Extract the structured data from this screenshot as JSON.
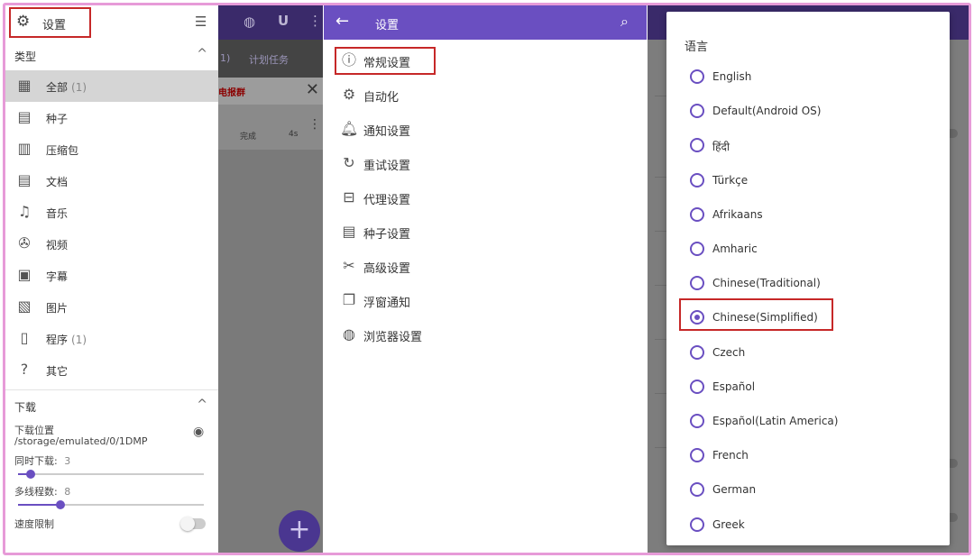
{
  "drawer": {
    "title": "设置",
    "types_header": "类型",
    "categories": [
      {
        "label": "全部",
        "count": "(1)",
        "icon": "grid-icon"
      },
      {
        "label": "种子",
        "count": "",
        "icon": "torrent-file-icon"
      },
      {
        "label": "压缩包",
        "count": "",
        "icon": "archive-icon"
      },
      {
        "label": "文档",
        "count": "",
        "icon": "document-icon"
      },
      {
        "label": "音乐",
        "count": "",
        "icon": "music-note-icon"
      },
      {
        "label": "视频",
        "count": "",
        "icon": "film-reel-icon"
      },
      {
        "label": "字幕",
        "count": "",
        "icon": "subtitle-icon"
      },
      {
        "label": "图片",
        "count": "",
        "icon": "image-icon"
      },
      {
        "label": "程序",
        "count": "(1)",
        "icon": "phone-app-icon"
      },
      {
        "label": "其它",
        "count": "",
        "icon": "question-file-icon"
      }
    ],
    "download_header": "下载",
    "download_location_label": "下载位置",
    "download_location_value": "/storage/emulated/0/1DMP",
    "concurrent_label": "同时下载:",
    "concurrent_value": "3",
    "concurrent_fraction": 0.07,
    "threads_label": "多线程数:",
    "threads_value": "8",
    "threads_fraction": 0.23,
    "speed_limit_label": "速度限制",
    "speed_limit_on": false
  },
  "bg_app": {
    "tab_fragment_1": "1)",
    "tab_fragment_2": "计划任务",
    "alert_text": "电报群",
    "row_status": "完成",
    "row_time": "4s"
  },
  "settings": {
    "title": "设置",
    "items": [
      {
        "label": "常规设置",
        "icon": "info-icon"
      },
      {
        "label": "自动化",
        "icon": "automation-icon"
      },
      {
        "label": "通知设置",
        "icon": "bell-icon"
      },
      {
        "label": "重试设置",
        "icon": "retry-icon"
      },
      {
        "label": "代理设置",
        "icon": "proxy-icon"
      },
      {
        "label": "种子设置",
        "icon": "torrent-file-icon"
      },
      {
        "label": "高级设置",
        "icon": "tools-icon"
      },
      {
        "label": "浮窗通知",
        "icon": "floating-window-icon"
      },
      {
        "label": "浏览器设置",
        "icon": "globe-icon"
      }
    ]
  },
  "language_dialog": {
    "title": "语言",
    "options": [
      "English",
      "Default(Android OS)",
      "हिंदी",
      "Türkçe",
      "Afrikaans",
      "Amharic",
      "Chinese(Traditional)",
      "Chinese(Simplified)",
      "Czech",
      "Español",
      "Español(Latin America)",
      "French",
      "German",
      "Greek"
    ],
    "selected": "Chinese(Simplified)"
  },
  "colors": {
    "accent": "#6a4fc1",
    "highlight_border": "#c62828",
    "frame_border": "#e79bd8"
  }
}
